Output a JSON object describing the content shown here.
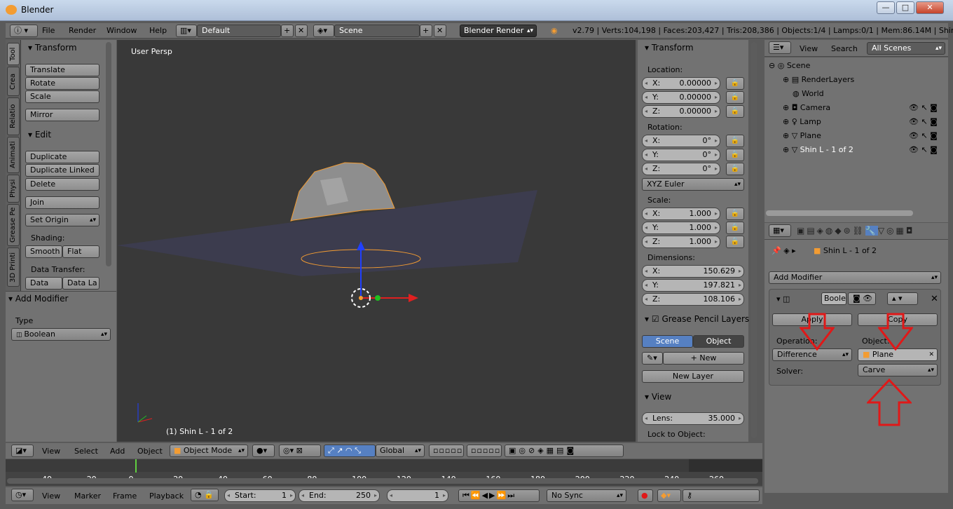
{
  "window": {
    "title": "Blender",
    "min": "—",
    "max": "□",
    "close": "✕"
  },
  "header": {
    "menus": [
      "File",
      "Render",
      "Window",
      "Help"
    ],
    "layout": "Default",
    "scene": "Scene",
    "engine": "Blender Render",
    "stats": "v2.79 | Verts:104,198 | Faces:203,427 | Tris:208,386 | Objects:1/4 | Lamps:0/1 | Mem:86.14M | Shin L - 1 of 2"
  },
  "tool_tabs": [
    "Tool",
    "Crea",
    "Relatio",
    "Animati",
    "Physi",
    "Grease Pe",
    "3D Printi"
  ],
  "tool_shelf": {
    "transform_title": "Transform",
    "translate": "Translate",
    "rotate": "Rotate",
    "scale": "Scale",
    "mirror": "Mirror",
    "edit_title": "Edit",
    "duplicate": "Duplicate",
    "duplicate_linked": "Duplicate Linked",
    "delete": "Delete",
    "join": "Join",
    "set_origin": "Set Origin",
    "shading_label": "Shading:",
    "smooth": "Smooth",
    "flat": "Flat",
    "data_transfer_label": "Data Transfer:",
    "data": "Data",
    "data_la": "Data La",
    "add_modifier_title": "Add Modifier",
    "type_label": "Type",
    "type_value": "Boolean"
  },
  "viewport": {
    "label": "User Persp",
    "object_label": "(1) Shin L - 1 of 2"
  },
  "nprops": {
    "transform_title": "Transform",
    "location_label": "Location:",
    "location": [
      [
        "X:",
        "0.00000"
      ],
      [
        "Y:",
        "0.00000"
      ],
      [
        "Z:",
        "0.00000"
      ]
    ],
    "rotation_label": "Rotation:",
    "rotation": [
      [
        "X:",
        "0°"
      ],
      [
        "Y:",
        "0°"
      ],
      [
        "Z:",
        "0°"
      ]
    ],
    "rot_mode": "XYZ Euler",
    "scale_label": "Scale:",
    "scale": [
      [
        "X:",
        "1.000"
      ],
      [
        "Y:",
        "1.000"
      ],
      [
        "Z:",
        "1.000"
      ]
    ],
    "dims_label": "Dimensions:",
    "dims": [
      [
        "X:",
        "150.629"
      ],
      [
        "Y:",
        "197.821"
      ],
      [
        "Z:",
        "108.106"
      ]
    ],
    "gp_title": "Grease Pencil Layers",
    "gp_scene": "Scene",
    "gp_object": "Object",
    "gp_new": "New",
    "gp_new_layer": "New Layer",
    "view_title": "View",
    "lens_label": "Lens:",
    "lens_value": "35.000",
    "lock_label": "Lock to Object:"
  },
  "outliner": {
    "view": "View",
    "search": "Search",
    "filter": "All Scenes",
    "items": [
      "Scene",
      "RenderLayers",
      "World",
      "Camera",
      "Lamp",
      "Plane",
      "Shin L - 1 of 2"
    ]
  },
  "properties": {
    "object_path": "Shin L - 1 of 2",
    "add_modifier": "Add Modifier",
    "mod_name": "Boole",
    "apply": "Apply",
    "copy": "Copy",
    "operation_label": "Operation:",
    "operation": "Difference",
    "object_label": "Object:",
    "object": "Plane",
    "solver_label": "Solver:",
    "solver": "Carve"
  },
  "vp_header": {
    "menus": [
      "View",
      "Select",
      "Add",
      "Object"
    ],
    "mode": "Object Mode",
    "orientation": "Global"
  },
  "timeline": {
    "ticks": [
      "-40",
      "-20",
      "0",
      "20",
      "40",
      "60",
      "80",
      "100",
      "120",
      "140",
      "160",
      "180",
      "200",
      "220",
      "240",
      "260"
    ]
  },
  "tl_header": {
    "menus": [
      "View",
      "Marker",
      "Frame",
      "Playback"
    ],
    "start_label": "Start:",
    "start": "1",
    "end_label": "End:",
    "end": "250",
    "current": "1",
    "sync": "No Sync"
  },
  "colors": {
    "accent": "#5680c2",
    "selected": "#f39c32",
    "arrow": "#e01818"
  }
}
